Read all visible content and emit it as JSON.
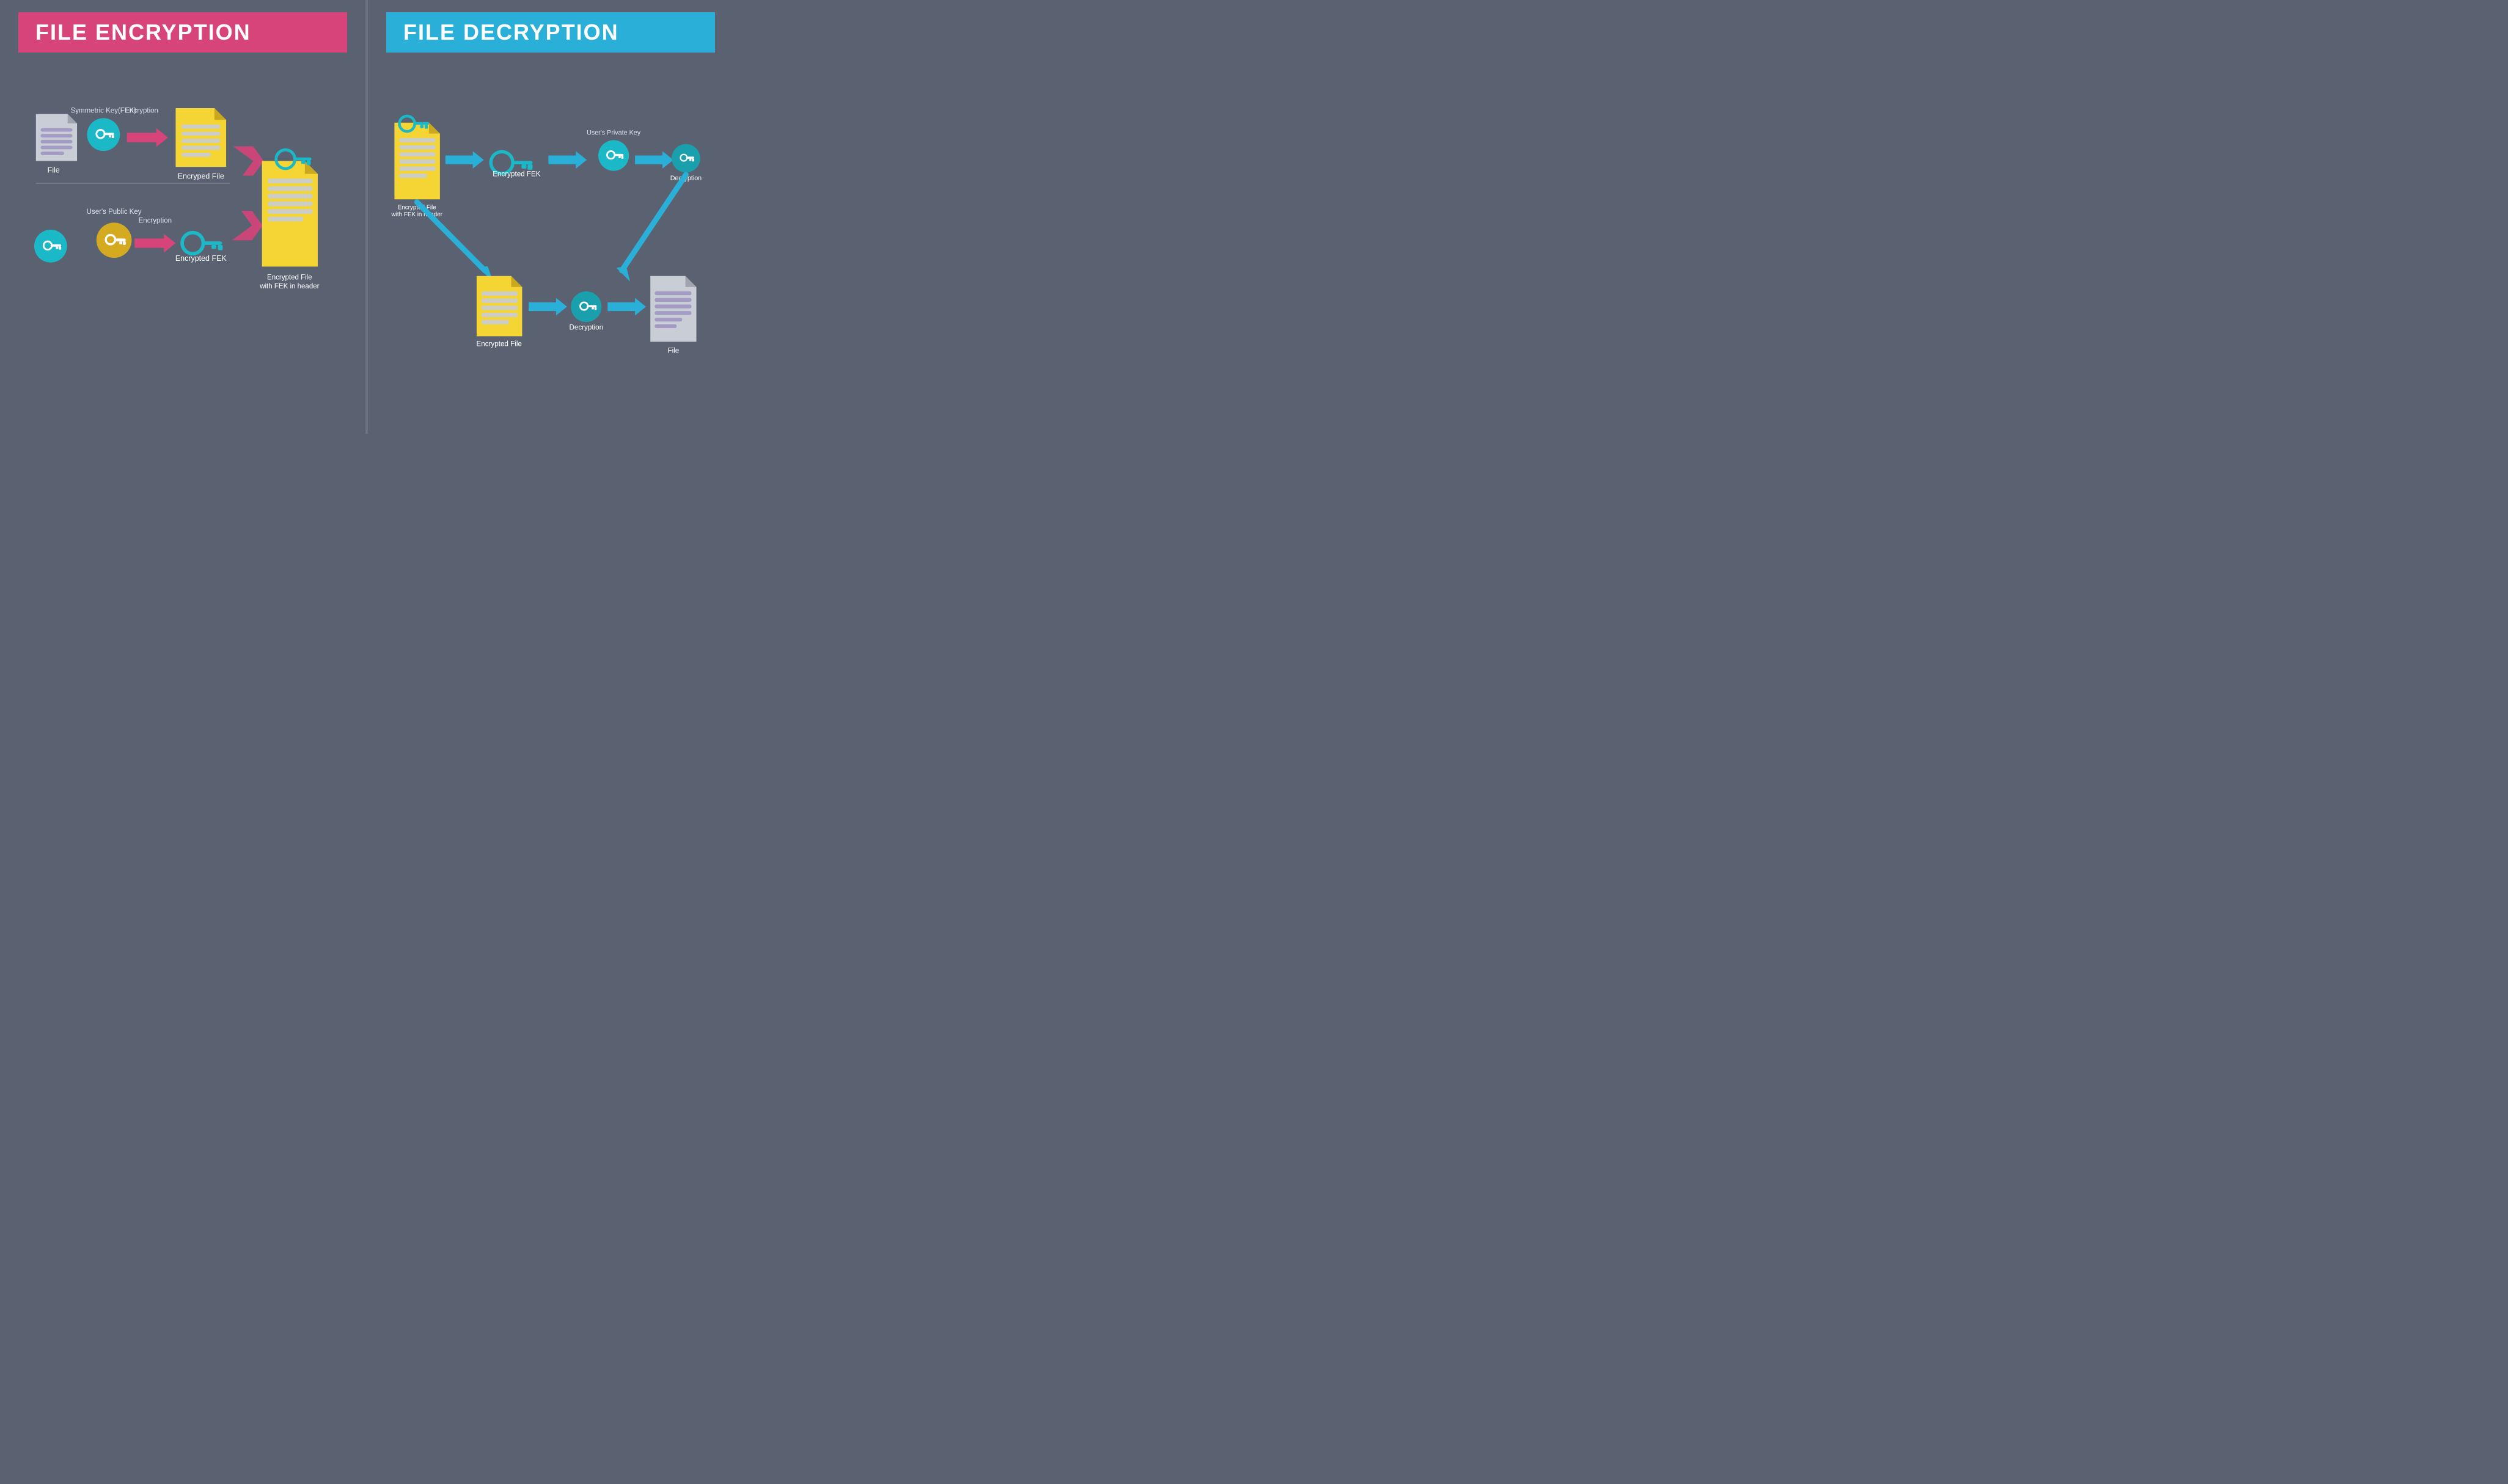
{
  "left": {
    "title": "FILE ENCRYPTION",
    "rows": {
      "top": {
        "file_label": "File",
        "sym_key_label": "Symmetric Key(FEK)",
        "encryption_label": "Encryption",
        "encrypted_file_label": "Encryped File"
      },
      "bottom": {
        "pub_key_label": "User's Public Key",
        "encryption2_label": "Encryption",
        "encrypted_fek_label": "Encrypted FEK"
      },
      "right": {
        "encrypted_file_header_label": "Encrypted File\nwith FEK in header"
      }
    }
  },
  "right": {
    "title": "FILE DECRYPTION",
    "rows": {
      "top": {
        "enc_file_fek_label": "Encrypted File\nwith FEK in header",
        "enc_fek_label": "Encrypted FEK",
        "priv_key_label": "User's Private Key",
        "decryption1_label": "Decryption"
      },
      "bottom": {
        "encrypted_file_label": "Encrypted File",
        "decryption2_label": "Decryption",
        "file_label": "File"
      }
    }
  }
}
